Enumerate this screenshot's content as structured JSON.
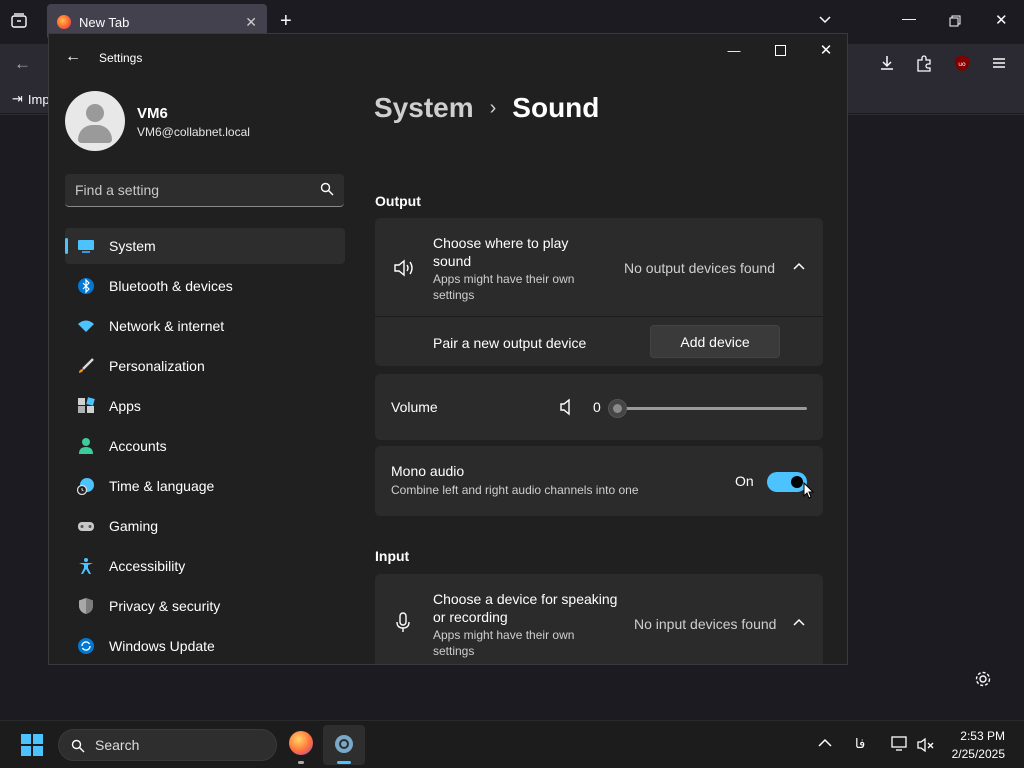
{
  "browser": {
    "tab_title": "New Tab",
    "bookmark_item": "Imp"
  },
  "settings": {
    "window_title": "Settings",
    "profile": {
      "name": "VM6",
      "email": "VM6@collabnet.local"
    },
    "search": {
      "placeholder": "Find a setting"
    },
    "nav": [
      {
        "label": "System",
        "icon": "system-icon",
        "active": true
      },
      {
        "label": "Bluetooth & devices",
        "icon": "bluetooth-icon"
      },
      {
        "label": "Network & internet",
        "icon": "wifi-icon"
      },
      {
        "label": "Personalization",
        "icon": "brush-icon"
      },
      {
        "label": "Apps",
        "icon": "apps-icon"
      },
      {
        "label": "Accounts",
        "icon": "account-icon"
      },
      {
        "label": "Time & language",
        "icon": "clock-globe-icon"
      },
      {
        "label": "Gaming",
        "icon": "gamepad-icon"
      },
      {
        "label": "Accessibility",
        "icon": "accessibility-icon"
      },
      {
        "label": "Privacy & security",
        "icon": "shield-icon"
      },
      {
        "label": "Windows Update",
        "icon": "update-icon"
      }
    ],
    "breadcrumb": {
      "parent": "System",
      "separator": "›",
      "current": "Sound"
    },
    "output": {
      "section_title": "Output",
      "choose_title": "Choose where to play sound",
      "choose_sub": "Apps might have their own settings",
      "choose_value": "No output devices found",
      "pair_label": "Pair a new output device",
      "add_device_label": "Add device",
      "volume_label": "Volume",
      "volume_value": "0",
      "mono_title": "Mono audio",
      "mono_sub": "Combine left and right audio channels into one",
      "mono_state": "On"
    },
    "input": {
      "section_title": "Input",
      "choose_title": "Choose a device for speaking or recording",
      "choose_sub": "Apps might have their own settings",
      "choose_value": "No input devices found"
    }
  },
  "taskbar": {
    "search_label": "Search",
    "time": "2:53 PM",
    "date": "2/25/2025",
    "tray_lang": "فا"
  },
  "colors": {
    "accent": "#4cc2ff",
    "window_bg": "#202020",
    "card_bg": "#2b2b2b"
  }
}
